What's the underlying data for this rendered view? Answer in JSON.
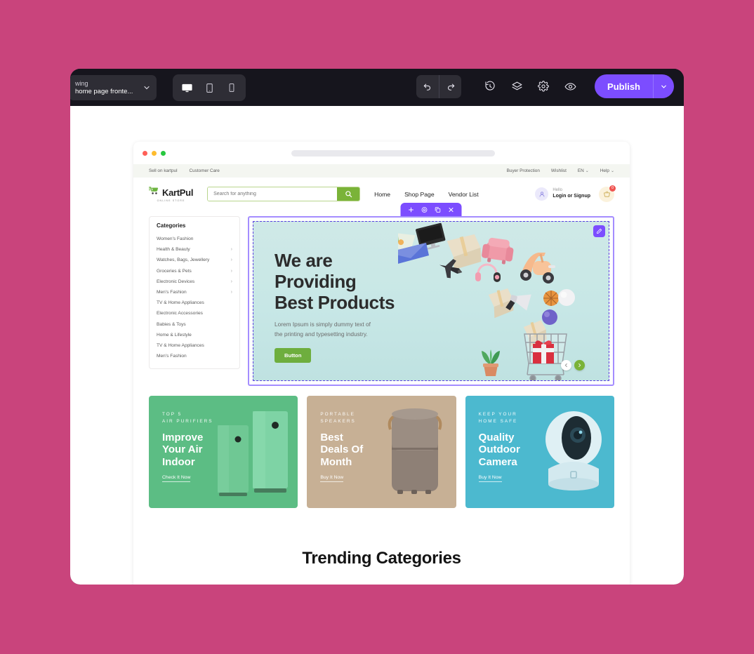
{
  "editor": {
    "page_select": {
      "line1": "wing",
      "line2": "home page fronte...",
      "icon": "chevron-down-icon"
    },
    "devices": [
      {
        "name": "desktop",
        "icon": "desktop-icon",
        "active": true
      },
      {
        "name": "tablet",
        "icon": "tablet-icon",
        "active": false
      },
      {
        "name": "mobile",
        "icon": "mobile-icon",
        "active": false
      }
    ],
    "tools": [
      {
        "name": "undo",
        "icon": "undo-icon"
      },
      {
        "name": "redo",
        "icon": "redo-icon"
      },
      {
        "name": "history",
        "icon": "history-clock-icon"
      },
      {
        "name": "layers",
        "icon": "layers-icon"
      },
      {
        "name": "settings",
        "icon": "gear-icon"
      },
      {
        "name": "preview",
        "icon": "eye-icon"
      }
    ],
    "publish_label": "Publish",
    "publish_caret_icon": "chevron-down-icon",
    "selection_toolbar": [
      {
        "name": "add",
        "icon": "plus-icon"
      },
      {
        "name": "settings",
        "icon": "gear-icon"
      },
      {
        "name": "duplicate",
        "icon": "copy-icon"
      },
      {
        "name": "remove",
        "icon": "close-icon"
      }
    ],
    "edit_badge_icon": "pencil-icon",
    "accent": "#7c4dff",
    "toolbar_bg": "#16151d"
  },
  "browser": {
    "dots": [
      "#ff5f57",
      "#febc2e",
      "#28c840"
    ],
    "url_placeholder": ""
  },
  "site": {
    "topbar": {
      "left": [
        "Sell on kartpul",
        "Customer Care"
      ],
      "right": [
        {
          "label": "Buyer Protection",
          "caret": false
        },
        {
          "label": "Wishlist",
          "caret": false
        },
        {
          "label": "EN",
          "caret": true
        },
        {
          "label": "Help",
          "caret": true
        }
      ]
    },
    "header": {
      "logo_text": "KartPul",
      "logo_sub": "ONLINE STORE",
      "logo_icon": "shopping-cart-icon",
      "search_placeholder": "Search for anything",
      "search_value": "",
      "search_icon": "search-icon",
      "nav": [
        "Home",
        "Shop Page",
        "Vendor List"
      ],
      "account": {
        "hello": "Hello",
        "action": "Login or Signup",
        "icon": "user-icon"
      },
      "cart": {
        "icon": "basket-icon",
        "count": "0"
      }
    },
    "categories": {
      "title": "Categories",
      "items": [
        {
          "label": "Women's Fashion",
          "arrow": false
        },
        {
          "label": "Health & Beauty",
          "arrow": true
        },
        {
          "label": "Watches, Bags, Jewellery",
          "arrow": true
        },
        {
          "label": "Groceries & Pets",
          "arrow": true
        },
        {
          "label": "Electronic Devices",
          "arrow": true
        },
        {
          "label": "Men's Fashion",
          "arrow": true
        },
        {
          "label": "TV & Home Appliances",
          "arrow": false
        },
        {
          "label": "Electronic Accessories",
          "arrow": false
        },
        {
          "label": "Babies & Toys",
          "arrow": false
        },
        {
          "label": "Home & Lifestyle",
          "arrow": false
        },
        {
          "label": "TV & Home Appliances",
          "arrow": false
        },
        {
          "label": "Men's Fashion",
          "arrow": false
        }
      ]
    },
    "hero": {
      "title_line1": "We are",
      "title_line2": "Providing",
      "title_line3": "Best Products",
      "desc_line1": "Lorem Ipsum is simply dummy text of",
      "desc_line2": "the printing and typesetting industry.",
      "button_label": "Button",
      "button_color": "#6eae3e",
      "bg_color": "#c7e7e6",
      "prev_icon": "chevron-left-icon",
      "next_icon": "chevron-right-icon"
    },
    "promos": [
      {
        "kicker_line1": "TOP 5",
        "kicker_line2": "AIR PURIFIERS",
        "title_line1": "Improve",
        "title_line2": "Your Air",
        "title_line3": "Indoor",
        "link": "Check It Now",
        "bg": "#5cbd84",
        "art": "air-purifier-illustration"
      },
      {
        "kicker_line1": "PORTABLE",
        "kicker_line2": "SPEAKERS",
        "title_line1": "Best",
        "title_line2": "Deals Of",
        "title_line3": "Month",
        "link": "Buy It Now",
        "bg": "#c7b095",
        "art": "speaker-illustration"
      },
      {
        "kicker_line1": "KEEP YOUR",
        "kicker_line2": "HOME SAFE",
        "title_line1": "Quality",
        "title_line2": "Outdoor",
        "title_line3": "Camera",
        "link": "Buy It Now",
        "bg": "#4cb9cf",
        "art": "security-camera-illustration"
      }
    ],
    "trending_title": "Trending Categories"
  }
}
